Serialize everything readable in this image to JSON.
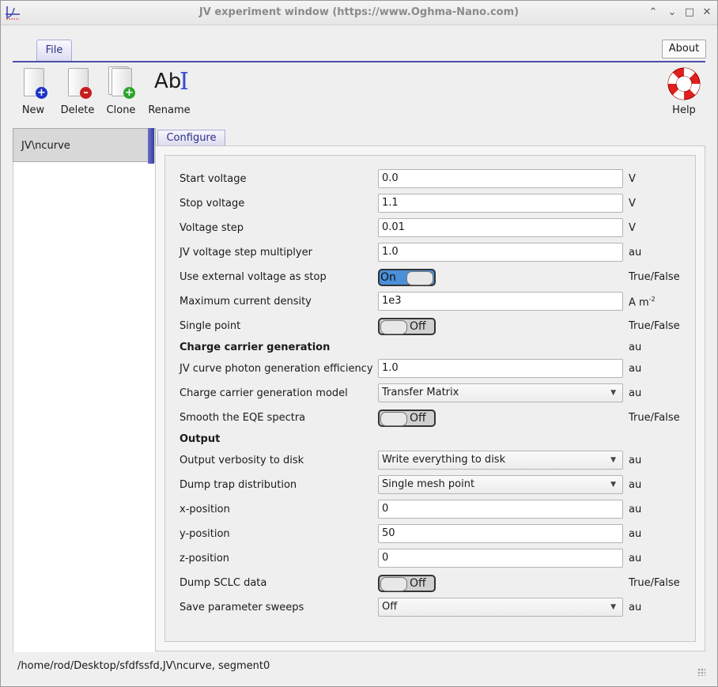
{
  "window": {
    "title": "JV experiment window (https://www.Oghma-Nano.com)"
  },
  "menu": {
    "file_tab": "File",
    "about": "About"
  },
  "toolbar": {
    "new": "New",
    "delete": "Delete",
    "clone": "Clone",
    "rename": "Rename",
    "rename_icon_text": "Ab",
    "help": "Help"
  },
  "sidebar": {
    "items": [
      {
        "label": "JV\\ncurve"
      }
    ]
  },
  "tabs": {
    "configure": "Configure"
  },
  "form": {
    "start_voltage": {
      "label": "Start voltage",
      "value": "0.0",
      "unit": "V"
    },
    "stop_voltage": {
      "label": "Stop voltage",
      "value": "1.1",
      "unit": "V"
    },
    "voltage_step": {
      "label": "Voltage step",
      "value": "0.01",
      "unit": "V"
    },
    "step_multiplyer": {
      "label": "JV voltage step multiplyer",
      "value": "1.0",
      "unit": "au"
    },
    "external_voltage": {
      "label": "Use external voltage as stop",
      "value": "On",
      "unit": "True/False"
    },
    "max_current": {
      "label": "Maximum current density",
      "value": "1e3",
      "unit": "A m",
      "unit_sup": "-2"
    },
    "single_point": {
      "label": "Single point",
      "value": "Off",
      "unit": "True/False"
    },
    "ccg_heading": {
      "label": "Charge carrier generation",
      "unit": "au"
    },
    "photon_eff": {
      "label": "JV curve photon generation efficiency",
      "value": "1.0",
      "unit": "au"
    },
    "gen_model": {
      "label": "Charge carrier generation model",
      "value": "Transfer Matrix",
      "unit": "au"
    },
    "smooth_eqe": {
      "label": "Smooth the EQE spectra",
      "value": "Off",
      "unit": "True/False"
    },
    "output_heading": {
      "label": "Output"
    },
    "verbosity": {
      "label": "Output verbosity to disk",
      "value": "Write everything to disk",
      "unit": "au"
    },
    "dump_trap": {
      "label": "Dump trap distribution",
      "value": "Single mesh point",
      "unit": "au"
    },
    "x_position": {
      "label": "x-position",
      "value": "0",
      "unit": "au"
    },
    "y_position": {
      "label": "y-position",
      "value": "50",
      "unit": "au"
    },
    "z_position": {
      "label": "z-position",
      "value": "0",
      "unit": "au"
    },
    "dump_sclc": {
      "label": "Dump SCLC data",
      "value": "Off",
      "unit": "True/False"
    },
    "save_sweeps": {
      "label": "Save parameter sweeps",
      "value": "Off",
      "unit": "au"
    }
  },
  "status": {
    "path": "/home/rod/Desktop/sfdfssfd,JV\\ncurve, segment0"
  },
  "colors": {
    "accent": "#4a4ea8",
    "toggle_on": "#4a90d9"
  }
}
